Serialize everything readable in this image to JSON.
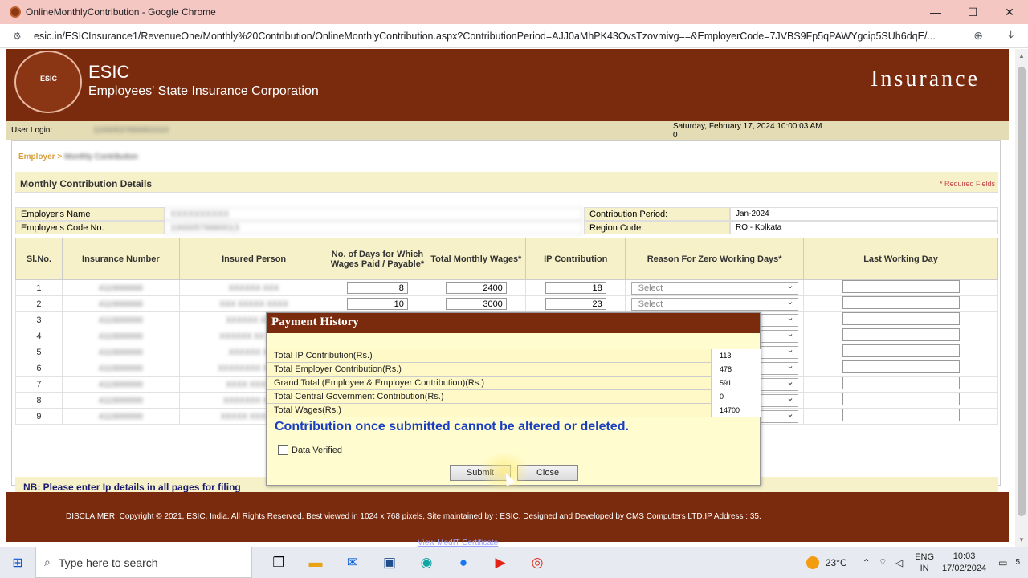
{
  "window": {
    "title": "OnlineMonthlyContribution - Google Chrome",
    "min": "—",
    "max": "☐",
    "close": "✕"
  },
  "browser": {
    "url": "esic.in/ESICInsurance1/RevenueOne/Monthly%20Contribution/OnlineMonthlyContribution.aspx?ContributionPeriod=AJJ0aMhPK43OvsTzovmivg==&EmployerCode=7JVBS9Fp5qPAWYgcip5SUh6dqE/..."
  },
  "header": {
    "logo_text": "ESIC",
    "brand": "ESIC",
    "org": "Employees' State Insurance Corporation",
    "section": "Insurance"
  },
  "userbar": {
    "label": "User Login:",
    "user_id": "11000537650001010",
    "datetime": "Saturday, February 17, 2024 10:00:03 AM",
    "count": "0"
  },
  "breadcrumb": {
    "root": "Employer >",
    "current": "Monthly Contribution"
  },
  "panel": {
    "title": "Monthly Contribution Details",
    "required": "* Required Fields"
  },
  "employer": {
    "name_label": "Employer's Name",
    "name_value": "XXXXXXXXXX",
    "code_label": "Employer's Code No.",
    "code_value": "10000576660013",
    "period_label": "Contribution Period:",
    "period_value": "Jan-2024",
    "region_label": "Region Code:",
    "region_value": "RO - Kolkata"
  },
  "grid": {
    "headers": [
      "Sl.No.",
      "Insurance Number",
      "Insured Person",
      "No. of Days for Which Wages Paid / Payable*",
      "Total Monthly Wages*",
      "IP Contribution",
      "Reason For Zero Working Days*",
      "Last Working Day"
    ],
    "rows": [
      {
        "sl": "1",
        "ins": "4110000000",
        "name": "XXXXXX XXX",
        "days": "8",
        "wages": "2400",
        "ip": "18",
        "reason": "Select"
      },
      {
        "sl": "2",
        "ins": "4110000000",
        "name": "XXX XXXXX XXXX",
        "days": "10",
        "wages": "3000",
        "ip": "23",
        "reason": "Select"
      },
      {
        "sl": "3",
        "ins": "4110000000",
        "name": "XXXXXX XXXX",
        "days": "",
        "wages": "",
        "ip": "",
        "reason": "Select"
      },
      {
        "sl": "4",
        "ins": "4110000000",
        "name": "XXXXXX XX XXXX",
        "days": "",
        "wages": "",
        "ip": "",
        "reason": "Select"
      },
      {
        "sl": "5",
        "ins": "4110000000",
        "name": "XXXXXX XXX",
        "days": "",
        "wages": "",
        "ip": "",
        "reason": "Select"
      },
      {
        "sl": "6",
        "ins": "4110000000",
        "name": "XXXXXXXX XXXXX",
        "days": "",
        "wages": "",
        "ip": "",
        "reason": "Select"
      },
      {
        "sl": "7",
        "ins": "4110000000",
        "name": "XXXX XXXXXX",
        "days": "",
        "wages": "",
        "ip": "",
        "reason": "Select"
      },
      {
        "sl": "8",
        "ins": "4110000000",
        "name": "XXXXXXX XXXX",
        "days": "",
        "wages": "",
        "ip": "",
        "reason": "Select"
      },
      {
        "sl": "9",
        "ins": "4110000000",
        "name": "XXXXX XXXXXXX",
        "days": "",
        "wages": "",
        "ip": "",
        "reason": "Select"
      }
    ]
  },
  "nb": "NB: Please enter Ip details in all pages for filing",
  "footer": {
    "disclaimer": "DISCLAIMER: Copyright © 2021, ESIC, India. All Rights Reserved. Best viewed in 1024 x 768 pixels, Site maintained by : ESIC. Designed and Developed by CMS Computers LTD.IP Address : 35.",
    "link": "View MedIT Certificate"
  },
  "dialog": {
    "title": "Payment History",
    "rows": [
      {
        "label": "Total IP Contribution(Rs.)",
        "value": "113"
      },
      {
        "label": "Total Employer Contribution(Rs.)",
        "value": "478"
      },
      {
        "label": "Grand Total (Employee & Employer Contribution)(Rs.)",
        "value": "591"
      },
      {
        "label": "Total Central Government Contribution(Rs.)",
        "value": "0"
      },
      {
        "label": "Total Wages(Rs.)",
        "value": "14700"
      }
    ],
    "warning": "Contribution once submitted cannot be altered or deleted.",
    "checkbox_label": "Data Verified",
    "submit": "Submit",
    "close": "Close"
  },
  "taskbar": {
    "search_placeholder": "Type here to search",
    "temp": "23°C",
    "lang1": "ENG",
    "lang2": "IN",
    "time": "10:03",
    "date": "17/02/2024",
    "notif": "5"
  }
}
